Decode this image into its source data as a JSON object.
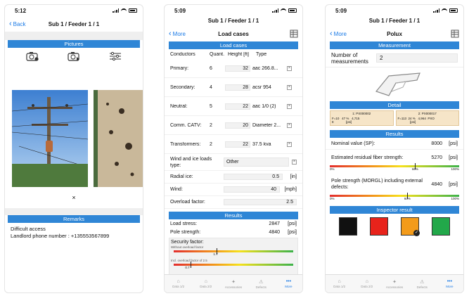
{
  "status": {
    "time1": "5:12",
    "time2": "5:09",
    "time3": "5:09"
  },
  "screen1": {
    "back": "Back",
    "title": "Sub 1 / Feeder 1 / 1",
    "pictures_header": "Pictures",
    "icons": [
      "camera-info-icon",
      "camera-video-icon",
      "list-settings-icon"
    ],
    "close_mark": "×",
    "remarks_header": "Remarks",
    "remarks": [
      "Difficult access",
      "Landlord phone number : +135553567899"
    ]
  },
  "screen2": {
    "title_top": "Sub 1 / Feeder 1 / 1",
    "back": "More",
    "title": "Load cases",
    "load_cases_header": "Load cases",
    "columns": [
      "Conductors",
      "Quant.",
      "Height [ft]",
      "Type"
    ],
    "rows": [
      {
        "label": "Primary:",
        "q": "6",
        "h": "32",
        "t": "aac 266.8..."
      },
      {
        "label": "Secondary:",
        "q": "4",
        "h": "28",
        "t": "acsr 954"
      },
      {
        "label": "Neutral:",
        "q": "5",
        "h": "22",
        "t": "aac 1/0 (2)"
      },
      {
        "label": "Comm. CATV:",
        "q": "2",
        "h": "20",
        "t": "Diameter 2..."
      },
      {
        "label": "Transformers:",
        "q": "2",
        "h": "22",
        "t": "37.5 kva"
      }
    ],
    "wind_label": "Wind and ice loads type:",
    "wind_value": "Other",
    "radial_label": "Radial ice:",
    "radial_value": "0.5",
    "radial_unit": "[in]",
    "wind_speed_label": "Wind:",
    "wind_speed_value": "40",
    "wind_speed_unit": "[mph]",
    "overload_label": "Overload factor:",
    "overload_value": "2.5",
    "results_header": "Results",
    "load_stress_label": "Load stress:",
    "load_stress_value": "2847",
    "load_stress_unit": "[psi]",
    "pole_strength_label": "Pole strength:",
    "pole_strength_value": "4840",
    "pole_strength_unit": "[psi]",
    "security_label": "Security factor:",
    "without_label": "Without overload factor",
    "without_value": "1.7",
    "without_fraction": 0.36,
    "incl_label": "Incl. overload factor of 2.5",
    "incl_value": "0.7",
    "incl_fraction": 0.14,
    "tabs": [
      "Data 1/2",
      "Data 2/2",
      "Accessories",
      "Defects",
      "More"
    ]
  },
  "screen3": {
    "title_top": "Sub 1 / Feeder 1 / 1",
    "back": "More",
    "title": "Polux",
    "measurement_header": "Measurement",
    "num_label": "Number of measurements",
    "num_value": "2",
    "detail_header": "Detail",
    "detail1_title": "1: PX000002",
    "detail1_line1": "F=10   47 %   4,715",
    "detail1_line2": "8              [psi]",
    "detail2_title": "2: PX000017",
    "detail2_line1": "F=113  24 %   4,964  PXO",
    "detail2_line2": "              [psi]",
    "results_header": "Results",
    "nominal_label": "Nominal value (SP):",
    "nominal_value": "8000",
    "nominal_unit": "[psi]",
    "residual_label": "Estimated residual fiber strength:",
    "residual_value": "5270",
    "residual_unit": "[psi]",
    "residual_pct": "66%",
    "residual_fraction": 0.66,
    "g_min": "0%",
    "g_max": "100%",
    "morgl_label": "Pole strength (MORGL) including external defects:",
    "morgl_value": "4840",
    "morgl_unit": "[psi]",
    "morgl_pct": "60%",
    "morgl_fraction": 0.6,
    "inspector_header": "Inspector result",
    "colors": [
      "#111111",
      "#e8231b",
      "#f39b1a",
      "#22a84a"
    ],
    "tabs": [
      "Data 1/2",
      "Data 2/2",
      "Accessories",
      "Defects",
      "More"
    ]
  }
}
